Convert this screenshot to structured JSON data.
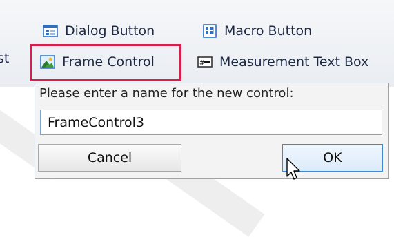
{
  "ribbon": {
    "partial_label": "st",
    "items": [
      {
        "name": "dialog-button",
        "label": "Dialog Button",
        "icon": "dialog-button-icon"
      },
      {
        "name": "macro-button",
        "label": "Macro Button",
        "icon": "macro-button-icon"
      },
      {
        "name": "frame-control",
        "label": "Frame Control",
        "icon": "frame-control-icon"
      },
      {
        "name": "measurement-text-box",
        "label": "Measurement Text Box",
        "icon": "measurement-text-box-icon"
      }
    ],
    "highlight_color": "#d6204b"
  },
  "dialog": {
    "prompt": "Please enter a name for the new control:",
    "input_value": "FrameControl3",
    "cancel_label": "Cancel",
    "ok_label": "OK"
  },
  "colors": {
    "accent": "#3c8ad6",
    "text": "#1e2a44"
  }
}
